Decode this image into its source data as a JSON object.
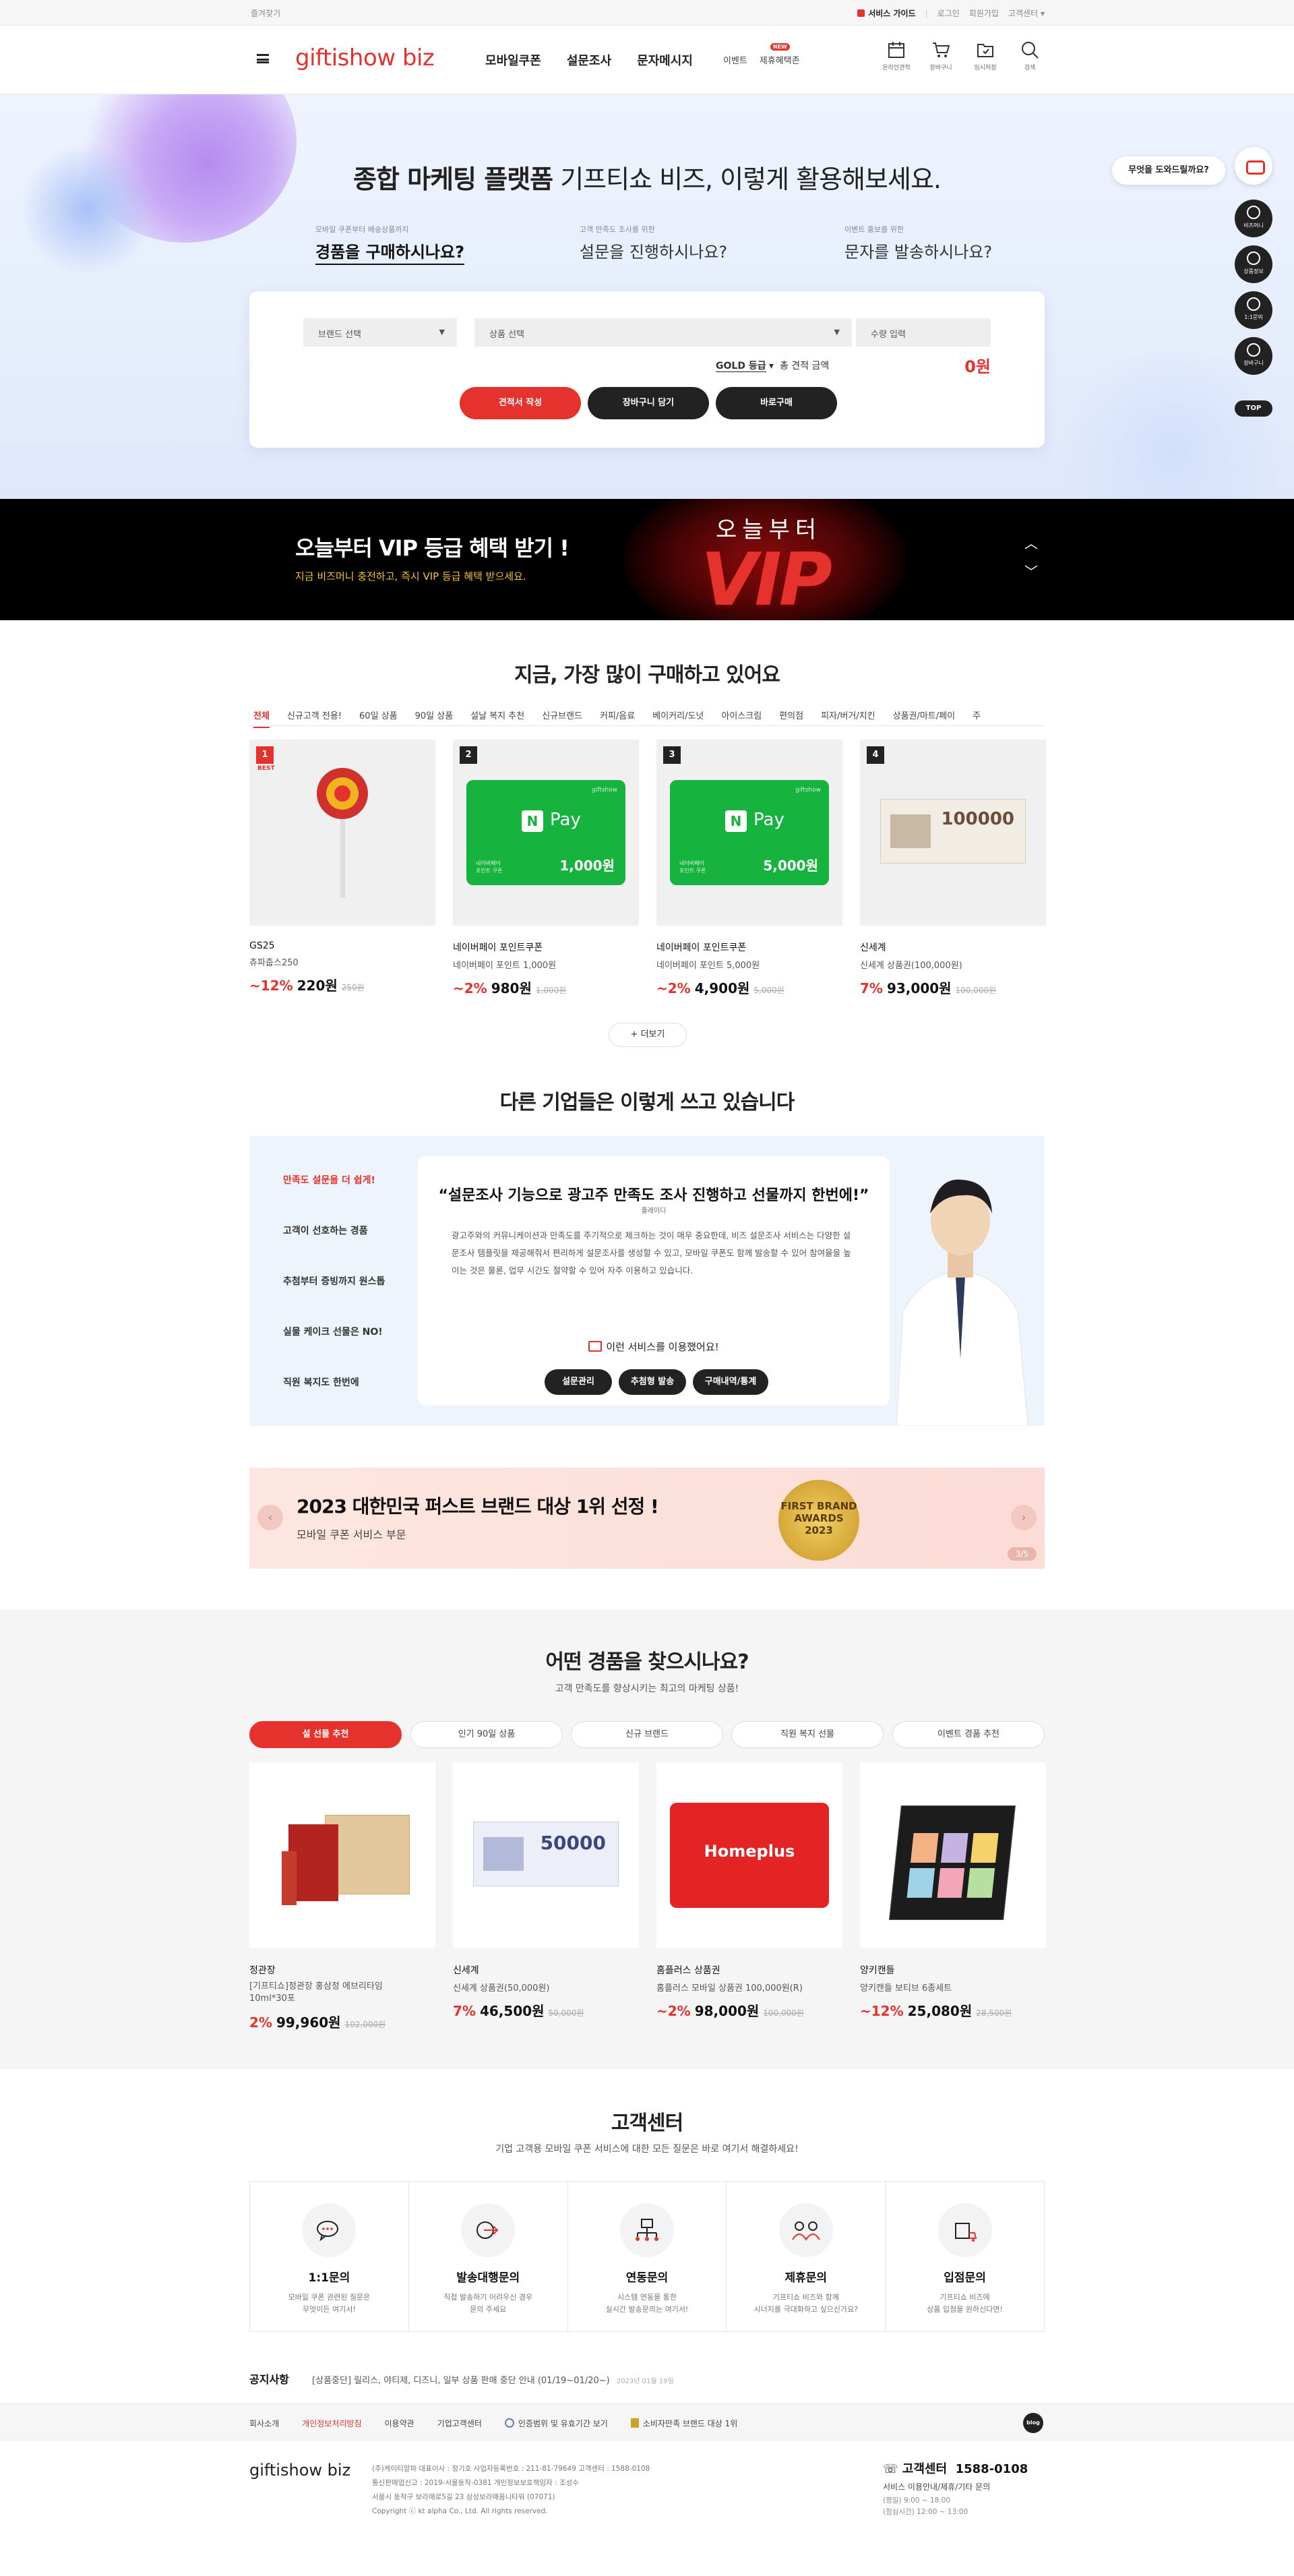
{
  "util": {
    "bookmark": "즐겨찾기",
    "guide": "서비스 가이드",
    "links": [
      "로그인",
      "회원가입",
      "고객센터"
    ]
  },
  "header": {
    "logo": "giftishow biz",
    "nav": [
      "모바일쿠폰",
      "설문조사",
      "문자메시지"
    ],
    "subnav": [
      "이벤트",
      "제휴혜택존"
    ],
    "new_badge": "NEW",
    "icons": [
      {
        "icon": "calendar-icon",
        "label": "온라인견적"
      },
      {
        "icon": "cart-icon",
        "label": "장바구니"
      },
      {
        "icon": "folder-icon",
        "label": "임시저장"
      },
      {
        "icon": "search-icon",
        "label": "검색"
      }
    ]
  },
  "hero": {
    "title_bold": "종합 마케팅 플랫폼",
    "title_rest": " 기프티쇼 비즈, 이렇게 활용해보세요.",
    "tabs": [
      {
        "small": "모바일 쿠폰부터 배송상품까지",
        "label": "경품을 구매하시나요?"
      },
      {
        "small": "고객 만족도 조사를 위한",
        "label": "설문을 진행하시나요?"
      },
      {
        "small": "이벤트 홍보를 위한",
        "label": "문자를 발송하시나요?"
      }
    ],
    "brand_select": "브랜드 선택",
    "product_select": "상품 선택",
    "qty_placeholder": "수량 입력",
    "grade": "GOLD 등급",
    "total_label": "총 견적 금액",
    "total": "0원",
    "buttons": [
      "견적서 작성",
      "장바구니 담기",
      "바로구매"
    ]
  },
  "quick": {
    "bubble": "무엇을 도와드릴까요?",
    "items": [
      "비즈머니",
      "상품정보",
      "1:1문의",
      "장바구니"
    ],
    "top": "TOP"
  },
  "vip": {
    "title": "오늘부터 VIP 등급 혜택 받기 !",
    "sub": "지금 비즈머니 충전하고, 즉시 VIP 등급 혜택 받으세요.",
    "img_text1": "오늘부터",
    "img_text2": "VIP"
  },
  "best": {
    "title": "지금, 가장 많이 구매하고 있어요",
    "tabs": [
      "전체",
      "신규고객 전용!",
      "60일 상품",
      "90일 상품",
      "설날 복지 추천",
      "신규브랜드",
      "커피/음료",
      "베이커리/도넛",
      "아이스크림",
      "편의점",
      "피자/버거/치킨",
      "상품권/마트/페이",
      "주"
    ],
    "best_label": "BEST",
    "products": [
      {
        "rank": "1",
        "brand": "GS25",
        "name": "츄파춥스250",
        "dc": "~12%",
        "price": "220원",
        "orig": "250원"
      },
      {
        "rank": "2",
        "brand": "네이버페이 포인트쿠폰",
        "name": "네이버페이 포인트 1,000원",
        "dc": "~2%",
        "price": "980원",
        "orig": "1,000원",
        "card_amt": "1,000원"
      },
      {
        "rank": "3",
        "brand": "네이버페이 포인트쿠폰",
        "name": "네이버페이 포인트 5,000원",
        "dc": "~2%",
        "price": "4,900원",
        "orig": "5,000원",
        "card_amt": "5,000원"
      },
      {
        "rank": "4",
        "brand": "신세계",
        "name": "신세계 상품권(100,000원)",
        "dc": "7%",
        "price": "93,000원",
        "orig": "100,000원",
        "card_amt": "100000"
      }
    ],
    "npay_label": "Pay",
    "npay_logo": "N",
    "npay_brand": "giftshow",
    "npay_small": "네이버페이\n포인트 쿠폰",
    "more": "+ 더보기"
  },
  "usage": {
    "title": "다른 기업들은 이렇게 쓰고 있습니다",
    "menu": [
      "만족도 설문을 더 쉽게!",
      "고객이 선호하는 경품",
      "추첨부터 증빙까지 원스톱",
      "실물 케이크 선물은 NO!",
      "직원 복지도 한번에"
    ],
    "quote": "“설문조사 기능으로 광고주 만족도 조사 진행하고 선물까지 한번에!”",
    "who": "플레이디",
    "body": "광고주와의 커뮤니케이션과 만족도를 주기적으로 체크하는 것이 매우 중요한데, 비즈 설문조사 서비스는 다양한 설문조사 템플릿을 제공해줘서 편리하게 설문조사를 생성할 수 있고, 모바일 쿠폰도 함께 발송할 수 있어 참여율을 높이는 것은 물론, 업무 시간도 절약할 수 있어 자주 이용하고 있습니다.",
    "used": "이런 서비스를 이용했어요!",
    "pills": [
      "설문관리",
      "추첨형 발송",
      "구매내역/통계"
    ]
  },
  "award": {
    "title": "2023 대한민국 퍼스트 브랜드 대상 1위 선정 !",
    "sub": "모바일 쿠폰 서비스 부문",
    "medal": "FIRST BRAND AWARDS 2023",
    "page": "3/5"
  },
  "rec": {
    "title": "어떤 경품을 찾으시나요?",
    "sub": "고객 만족도를 향상시키는 최고의 마케팅 상품!",
    "tabs": [
      "설 선물 추천",
      "인기 90일 상품",
      "신규 브랜드",
      "직원 복지 선물",
      "이벤트 경품 추천"
    ],
    "products": [
      {
        "brand": "정관장",
        "name": "[기프티쇼]정관장 홍삼정 에브리타임 10ml*30포",
        "dc": "2%",
        "price": "99,960원",
        "orig": "102,000원"
      },
      {
        "brand": "신세계",
        "name": "신세계 상품권(50,000원)",
        "dc": "7%",
        "price": "46,500원",
        "orig": "50,000원",
        "card_amt": "50000"
      },
      {
        "brand": "홈플러스 상품권",
        "name": "홈플러스 모바일 상품권 100,000원(R)",
        "dc": "~2%",
        "price": "98,000원",
        "orig": "100,000원",
        "card_logo": "Homeplus"
      },
      {
        "brand": "양키캔들",
        "name": "양키캔들 보티브 6종세트",
        "dc": "~12%",
        "price": "25,080원",
        "orig": "28,500원"
      }
    ]
  },
  "cs": {
    "title": "고객센터",
    "sub": "기업 고객용 모바일 쿠폰 서비스에 대한 모든 질문은 바로 여기서 해결하세요!",
    "items": [
      {
        "icon": "chat-icon",
        "title": "1:1문의",
        "desc": [
          "모바일 쿠폰 관련된 질문은",
          "무엇이든 여기서!"
        ]
      },
      {
        "icon": "send-icon",
        "title": "발송대행문의",
        "desc": [
          "직접 발송하기 어려우신 경우",
          "문의 주세요"
        ]
      },
      {
        "icon": "api-icon",
        "title": "연동문의",
        "desc": [
          "시스템 연동을 통한",
          "실시간 발송문의는 여기서!"
        ]
      },
      {
        "icon": "partner-icon",
        "title": "제휴문의",
        "desc": [
          "기프티쇼 비즈와 함께",
          "시너지를 극대화하고 싶으신가요?"
        ]
      },
      {
        "icon": "store-icon",
        "title": "입점문의",
        "desc": [
          "기프티쇼 비즈에",
          "상품 입점을 원하신다면!"
        ]
      }
    ]
  },
  "notice": {
    "label": "공지사항",
    "text": "[상품중단] 릴리스, 야티제, 디즈니, 일부 상품 판매 중단 안내 (01/19~01/20~)",
    "date": "2023년 01월 19일"
  },
  "footer": {
    "links": [
      "회사소개",
      "개인정보처리방침",
      "이용약관",
      "기업고객센터",
      "인증범위 및 유효기간 보기",
      "소비자만족 브랜드 대상 1위"
    ],
    "blog": "blog",
    "logo": "giftishow biz",
    "info": [
      "(주)케이티알파     대표이사 : 정기호     사업자등록번호 : 211-81-79649     고객센터 : 1588-0108",
      "통신판매업신고 : 2019-서울동작-0381     개인정보보호책임자 : 조성수",
      "서울시 동작구 보라매로5길 23 삼성보라매옴니타워 (07071)",
      "Copyright ⓒ kt alpha Co., Ltd. All rights reserved."
    ],
    "cs_label": "고객센터",
    "cs_phone": "1588-0108",
    "cs_desc": "서비스 이용안내/제휴/기타 문의",
    "cs_hours": [
      "(평일) 9:00 ~ 18:00",
      "(점심시간) 12:00 ~ 13:00"
    ]
  }
}
